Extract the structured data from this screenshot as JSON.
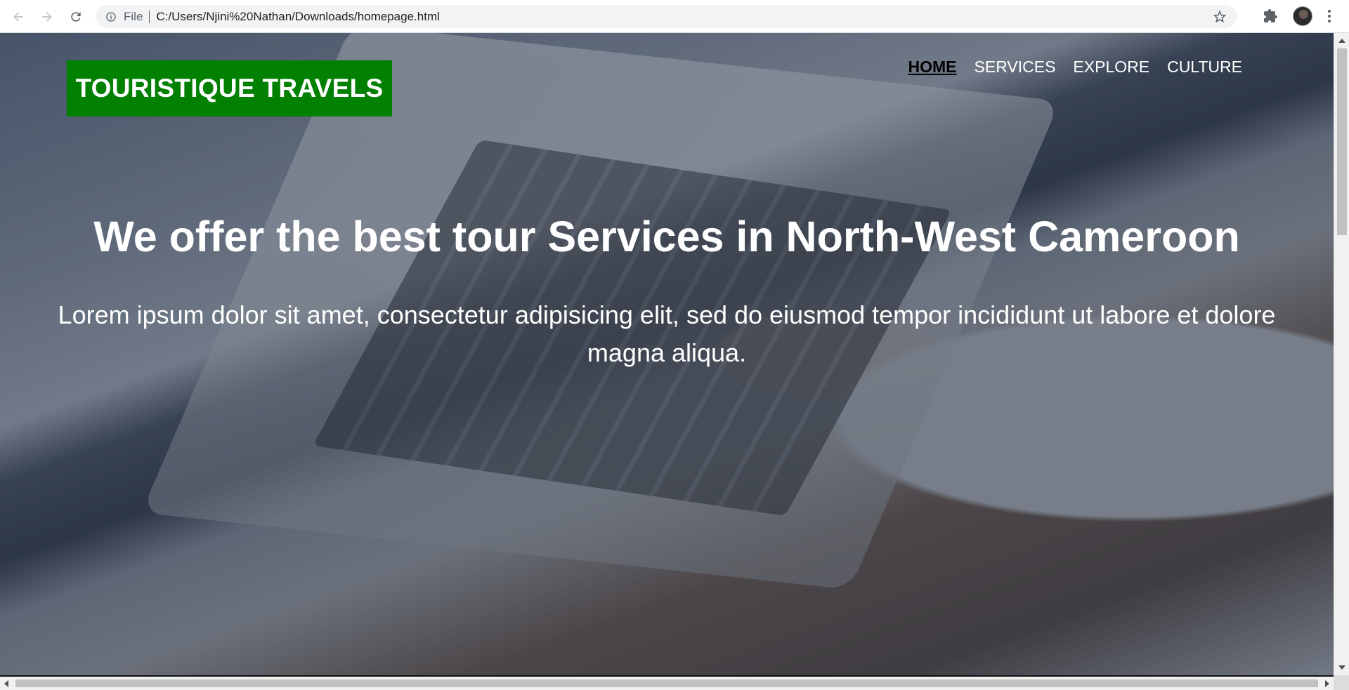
{
  "browser": {
    "url_scheme": "File",
    "url": "C:/Users/Njini%20Nathan/Downloads/homepage.html",
    "icons": {
      "back": "arrow-left-icon",
      "forward": "arrow-right-icon",
      "reload": "reload-icon",
      "site_info": "info-icon",
      "bookmark": "star-icon",
      "extensions": "puzzle-icon",
      "menu": "kebab-menu-icon"
    }
  },
  "site": {
    "logo_text": "TOURISTIQUE TRAVELS",
    "nav": [
      {
        "label": "HOME",
        "active": true
      },
      {
        "label": "SERVICES",
        "active": false
      },
      {
        "label": "EXPLORE",
        "active": false
      },
      {
        "label": "CULTURE",
        "active": false
      }
    ],
    "hero": {
      "headline": "We offer the best tour Services in North-West Cameroon",
      "subtext": "Lorem ipsum dolor sit amet, consectetur adipisicing elit, sed do eiusmod tempor incididunt ut labore et dolore magna aliqua."
    },
    "colors": {
      "logo_bg": "#028002",
      "nav_text": "#ffffff",
      "nav_active": "#000000"
    }
  }
}
